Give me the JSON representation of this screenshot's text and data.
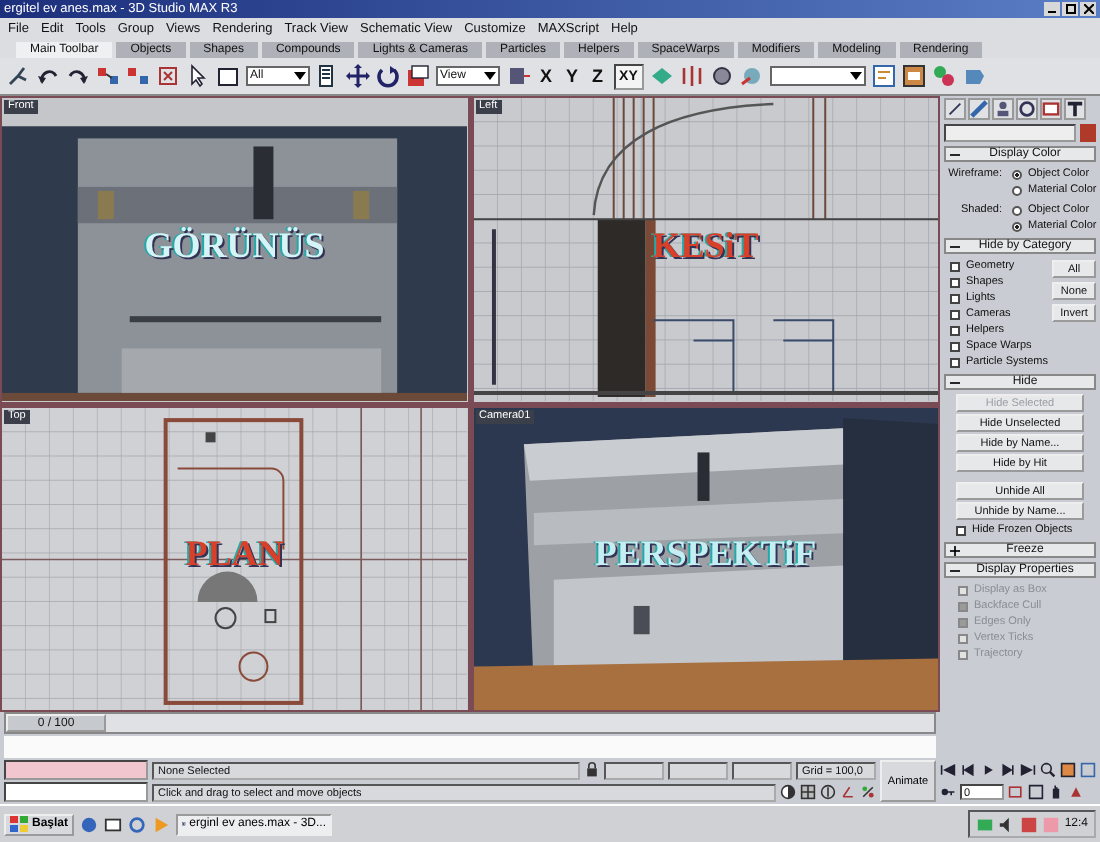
{
  "window": {
    "title": "ergitel ev anes.max - 3D Studio MAX R3"
  },
  "menu": [
    "File",
    "Edit",
    "Tools",
    "Group",
    "Views",
    "Rendering",
    "Track View",
    "Schematic View",
    "Customize",
    "MAXScript",
    "Help"
  ],
  "tabs": [
    {
      "label": "Main Toolbar",
      "selected": true
    },
    {
      "label": "Objects",
      "selected": false
    },
    {
      "label": "Shapes",
      "selected": false
    },
    {
      "label": "Compounds",
      "selected": false
    },
    {
      "label": "Lights & Cameras",
      "selected": false
    },
    {
      "label": "Particles",
      "selected": false
    },
    {
      "label": "Helpers",
      "selected": false
    },
    {
      "label": "SpaceWarps",
      "selected": false
    },
    {
      "label": "Modifiers",
      "selected": false
    },
    {
      "label": "Modeling",
      "selected": false
    },
    {
      "label": "Rendering",
      "selected": false
    }
  ],
  "toolbar": {
    "selection_filter": "All",
    "reference_coord": "View",
    "axes": [
      {
        "label": "X",
        "selected": false
      },
      {
        "label": "Y",
        "selected": false
      },
      {
        "label": "Z",
        "selected": false
      },
      {
        "label": "XY",
        "selected": true
      }
    ]
  },
  "viewports": [
    {
      "label": "Front",
      "title": "GÖRÜNÜS",
      "color": "#d6f3f5",
      "kind": "render"
    },
    {
      "label": "Left",
      "title": "KESiT",
      "color": "#d8402a",
      "kind": "section"
    },
    {
      "label": "Top",
      "title": "PLAN",
      "color": "#d8402a",
      "kind": "plan"
    },
    {
      "label": "Camera01",
      "title": "PERSPEKTiF",
      "color": "#c4eef2",
      "kind": "camera"
    }
  ],
  "command_panel": {
    "display_color": {
      "title": "Display Color",
      "expanded": true,
      "groups": [
        {
          "label": "Wireframe:",
          "options": [
            {
              "label": "Object Color",
              "selected": true
            },
            {
              "label": "Material Color",
              "selected": false
            }
          ]
        },
        {
          "label": "Shaded:",
          "options": [
            {
              "label": "Object Color",
              "selected": false
            },
            {
              "label": "Material Color",
              "selected": true
            }
          ]
        }
      ]
    },
    "hide_by_category": {
      "title": "Hide by Category",
      "expanded": true,
      "items": [
        {
          "label": "Geometry",
          "checked": false
        },
        {
          "label": "Shapes",
          "checked": false
        },
        {
          "label": "Lights",
          "checked": false
        },
        {
          "label": "Cameras",
          "checked": false
        },
        {
          "label": "Helpers",
          "checked": false
        },
        {
          "label": "Space Warps",
          "checked": false
        },
        {
          "label": "Particle Systems",
          "checked": false
        }
      ],
      "buttons": [
        "All",
        "None",
        "Invert"
      ]
    },
    "hide": {
      "title": "Hide",
      "expanded": true,
      "buttons": [
        {
          "label": "Hide Selected",
          "disabled": true
        },
        {
          "label": "Hide Unselected",
          "disabled": false
        },
        {
          "label": "Hide by Name...",
          "disabled": false
        },
        {
          "label": "Hide by Hit",
          "disabled": false
        },
        {
          "label": "Unhide All",
          "disabled": false
        },
        {
          "label": "Unhide by Name...",
          "disabled": false
        }
      ],
      "hide_frozen": {
        "label": "Hide Frozen Objects",
        "checked": false
      }
    },
    "freeze": {
      "title": "Freeze",
      "expanded": false
    },
    "display_properties": {
      "title": "Display Properties",
      "expanded": true,
      "items": [
        {
          "label": "Display as Box",
          "checked": false,
          "disabled": true
        },
        {
          "label": "Backface Cull",
          "checked": true,
          "disabled": true
        },
        {
          "label": "Edges Only",
          "checked": true,
          "disabled": true
        },
        {
          "label": "Vertex Ticks",
          "checked": false,
          "disabled": true
        },
        {
          "label": "Trajectory",
          "checked": false,
          "disabled": true
        }
      ]
    }
  },
  "time_slider": {
    "position": "0 / 100",
    "level": 0
  },
  "status": {
    "selection": "None Selected",
    "grid": "Grid = 100,0",
    "prompt": "Click and drag to select and move objects",
    "animate": "Animate",
    "frame": "0"
  },
  "taskbar": {
    "start": "Başlat",
    "tasks": [
      {
        "label": "erginl ev anes.max - 3D...",
        "selected": true
      }
    ],
    "clock": "12:4"
  }
}
